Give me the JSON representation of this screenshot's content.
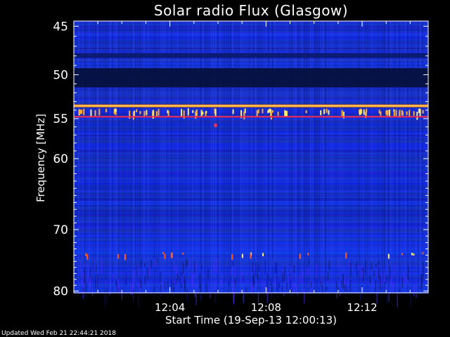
{
  "chart_data": {
    "type": "heatmap",
    "title": "Solar radio Flux (Glasgow)",
    "ylabel": "Frequency [MHz]",
    "xlabel": "Start Time (19-Sep-13 12:00:13)",
    "yticks": [
      "45",
      "50",
      "55",
      "60",
      "70",
      "80"
    ],
    "ytick_values": [
      45,
      50,
      55,
      60,
      70,
      80
    ],
    "xticks": [
      "12:04",
      "12:08",
      "12:12"
    ],
    "xtick_minutes": [
      4,
      8,
      12
    ],
    "xlim_minutes": [
      0.0,
      14.75
    ],
    "ylim_mhz": [
      44.5,
      80.3
    ],
    "y_scale": "log",
    "colormap": "blue-to-red (IDL)",
    "features": [
      {
        "kind": "dark band",
        "freq_mhz": [
          49.3,
          51.4
        ],
        "color": "#05103a"
      },
      {
        "kind": "dark band",
        "freq_mhz": [
          47.7,
          48.2
        ],
        "color": "#0a1a6a"
      },
      {
        "kind": "steady emission line",
        "freq_mhz": 53.5,
        "color": "#ff8800"
      },
      {
        "kind": "intermittent bursts",
        "freq_mhz": [
          53.8,
          54.8
        ],
        "color": "#ffaa30"
      },
      {
        "kind": "red line",
        "freq_mhz": 54.7,
        "color": "#ff2a55"
      },
      {
        "kind": "intermittent bursts",
        "freq_mhz": [
          73.5,
          74.5
        ],
        "color": "#ff5a20"
      }
    ]
  },
  "footer": {
    "updated": "Updated Wed Feb 21 22:44:21 2018"
  }
}
